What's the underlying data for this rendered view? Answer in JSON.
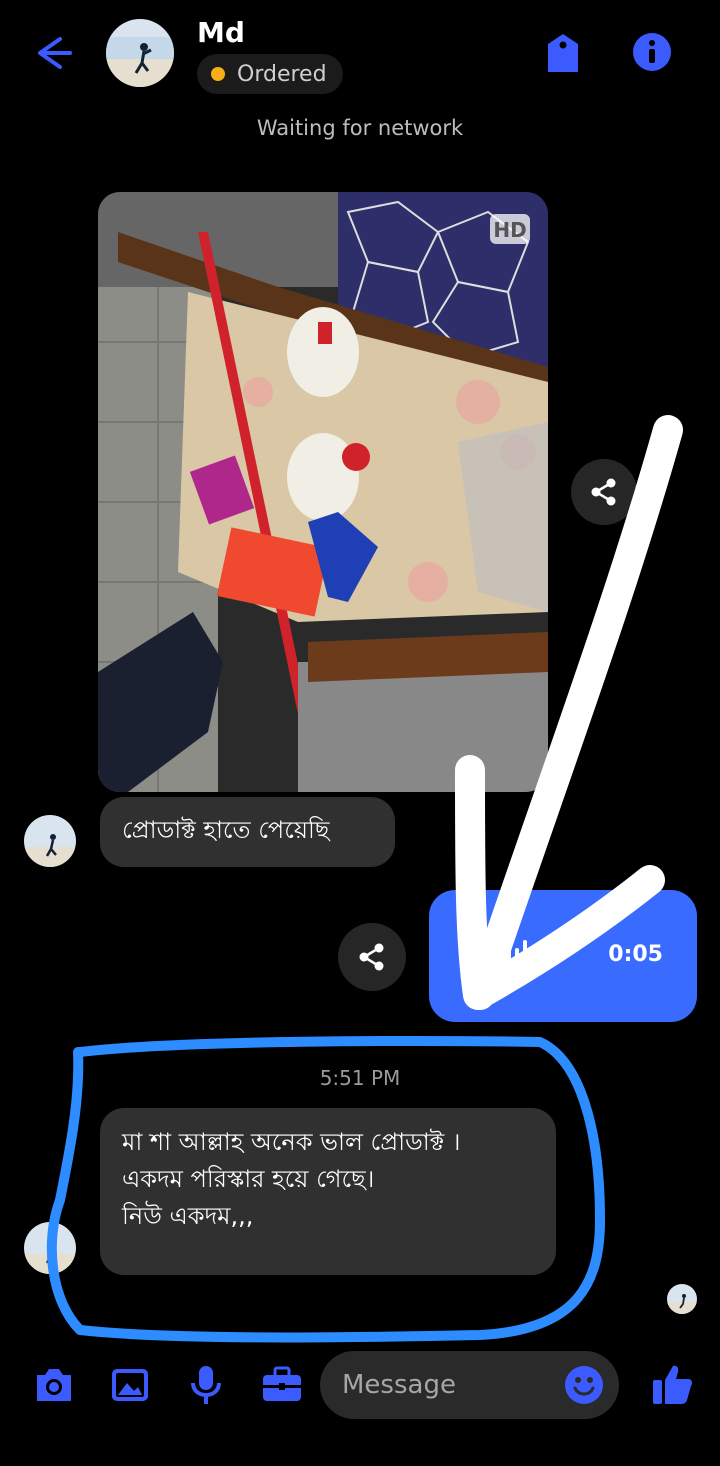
{
  "header": {
    "back_icon": "arrow-left-icon",
    "contact_name": "Md",
    "status_label": "Ordered",
    "status_color": "#f5b019",
    "tag_icon": "tag-icon",
    "info_icon": "info-icon"
  },
  "connection_status": "Waiting for network",
  "messages": {
    "photo": {
      "badge": "HD",
      "share_icon": "share-icon"
    },
    "incoming_1": "প্রোডাক্ট হাতে পেয়েছি",
    "voice": {
      "duration": "0:05",
      "share_icon": "share-icon",
      "color": "#3a6bff"
    },
    "timestamp": "5:51 PM",
    "incoming_2": [
      "মা শা আল্লাহ অনেক ভাল প্রোডাক্ট ।",
      "একদম পরিস্কার হয়ে গেছে।",
      "নিউ একদম,,,"
    ]
  },
  "composer": {
    "camera_icon": "camera-icon",
    "gallery_icon": "image-icon",
    "mic_icon": "mic-icon",
    "briefcase_icon": "briefcase-icon",
    "placeholder": "Message",
    "emoji_icon": "emoji-icon",
    "like_icon": "thumbs-up-icon",
    "accent": "#3b5bff"
  },
  "annotations": {
    "arrow_color": "#ffffff",
    "highlight_color": "#2d8cff"
  }
}
